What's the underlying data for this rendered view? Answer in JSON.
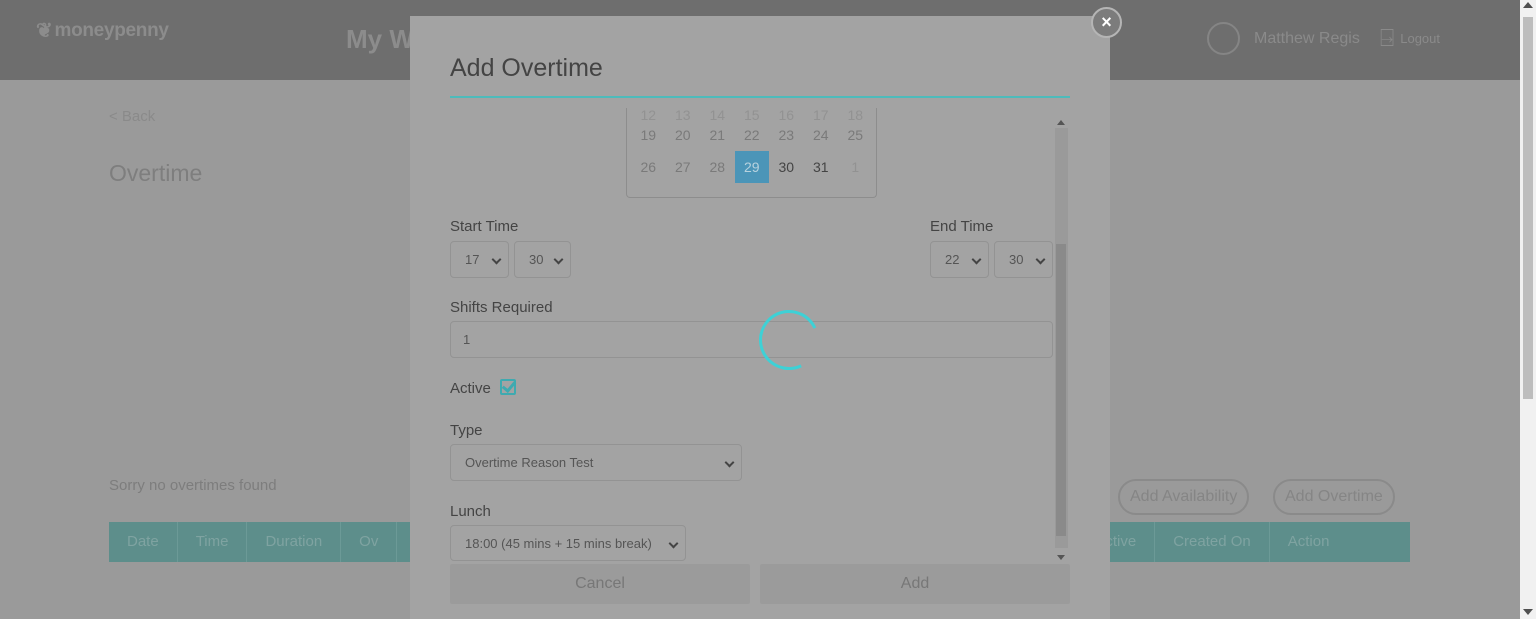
{
  "header": {
    "logo_text": "moneypenny",
    "app_title": "My W",
    "user_name": "Matthew Regis",
    "logout_label": "Logout"
  },
  "page": {
    "back_label": "< Back",
    "title": "Overtime",
    "empty_message": "Sorry no overtimes found",
    "add_availability_label": "Add Availability",
    "add_overtime_label": "Add Overtime",
    "table_columns": [
      "Date",
      "Time",
      "Duration",
      "Ov",
      "Active",
      "Created On",
      "Action"
    ]
  },
  "modal": {
    "title": "Add Overtime",
    "close_symbol": "×",
    "calendar": {
      "row_partial": [
        "12",
        "13",
        "14",
        "15",
        "16",
        "17",
        "18"
      ],
      "row1": [
        "19",
        "20",
        "21",
        "22",
        "23",
        "24",
        "25"
      ],
      "row2": [
        "26",
        "27",
        "28",
        "29",
        "30",
        "31",
        "1"
      ],
      "selected_day": "29"
    },
    "start_time": {
      "label": "Start Time",
      "hour": "17",
      "minute": "30"
    },
    "end_time": {
      "label": "End Time",
      "hour": "22",
      "minute": "30"
    },
    "shifts_required": {
      "label": "Shifts Required",
      "value": "1"
    },
    "active": {
      "label": "Active",
      "checked": true
    },
    "type": {
      "label": "Type",
      "value": "Overtime Reason Test"
    },
    "lunch": {
      "label": "Lunch",
      "value": "18:00 (45 mins + 15 mins break)"
    },
    "cancel_label": "Cancel",
    "add_label": "Add"
  },
  "colors": {
    "accent": "#3ed1d6",
    "selected_day": "#4b95b8",
    "overlay": "#9a9a9a"
  }
}
